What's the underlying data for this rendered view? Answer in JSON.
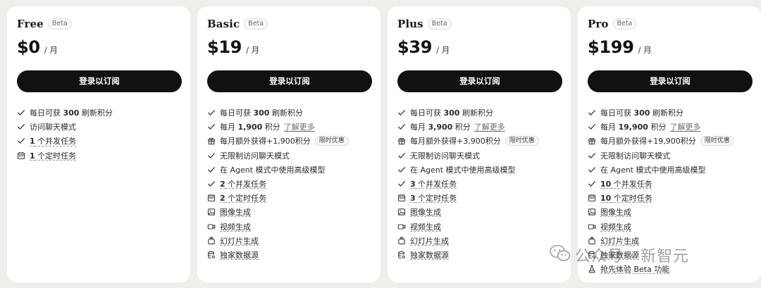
{
  "plans": [
    {
      "name": "Free",
      "badge": "Beta",
      "price": "$0",
      "period": "/ 月",
      "cta": "登录以订阅",
      "features": [
        {
          "icon": "check-icon",
          "pre": "每日可获 ",
          "bold": "300",
          "post": " 刷新积分"
        },
        {
          "icon": "check-icon",
          "pre": "访问聊天模式"
        },
        {
          "icon": "check-icon",
          "bold_ul": "1",
          "post_ul": " 个并发任务"
        },
        {
          "icon": "calendar-icon",
          "bold_ul": "1",
          "post_ul": " 个定时任务"
        }
      ]
    },
    {
      "name": "Basic",
      "badge": "Beta",
      "price": "$19",
      "period": "/ 月",
      "cta": "登录以订阅",
      "features": [
        {
          "icon": "check-icon",
          "pre": "每日可获 ",
          "bold": "300",
          "post": " 刷新积分"
        },
        {
          "icon": "check-icon",
          "pre": "每月 ",
          "bold": "1,900",
          "post": " 积分",
          "link": "了解更多"
        },
        {
          "icon": "gift-icon",
          "pre": "每月额外获得+1,900积分",
          "tag": "限时优惠"
        },
        {
          "icon": "check-icon",
          "pre": "无限制访问聊天模式"
        },
        {
          "icon": "check-icon",
          "pre": "在 Agent 模式中使用高级模型"
        },
        {
          "icon": "check-icon",
          "bold_ul": "2",
          "post_ul": " 个并发任务"
        },
        {
          "icon": "calendar-icon",
          "bold_ul": "2",
          "post_ul": " 个定时任务"
        },
        {
          "icon": "image-icon",
          "pre_ul": "图像生成"
        },
        {
          "icon": "video-icon",
          "pre_ul": "视频生成"
        },
        {
          "icon": "slides-icon",
          "pre_ul": "幻灯片生成"
        },
        {
          "icon": "database-icon",
          "pre_ul": "独家数据源"
        }
      ]
    },
    {
      "name": "Plus",
      "badge": "Beta",
      "price": "$39",
      "period": "/ 月",
      "cta": "登录以订阅",
      "features": [
        {
          "icon": "check-icon",
          "pre": "每日可获 ",
          "bold": "300",
          "post": " 刷新积分"
        },
        {
          "icon": "check-icon",
          "pre": "每月 ",
          "bold": "3,900",
          "post": " 积分",
          "link": "了解更多"
        },
        {
          "icon": "gift-icon",
          "pre": "每月额外获得+3,900积分",
          "tag": "限时优惠"
        },
        {
          "icon": "check-icon",
          "pre": "无限制访问聊天模式"
        },
        {
          "icon": "check-icon",
          "pre": "在 Agent 模式中使用高级模型"
        },
        {
          "icon": "check-icon",
          "bold_ul": "3",
          "post_ul": " 个并发任务"
        },
        {
          "icon": "calendar-icon",
          "bold_ul": "3",
          "post_ul": " 个定时任务"
        },
        {
          "icon": "image-icon",
          "pre_ul": "图像生成"
        },
        {
          "icon": "video-icon",
          "pre_ul": "视频生成"
        },
        {
          "icon": "slides-icon",
          "pre_ul": "幻灯片生成"
        },
        {
          "icon": "database-icon",
          "pre_ul": "独家数据源"
        }
      ]
    },
    {
      "name": "Pro",
      "badge": "Beta",
      "price": "$199",
      "period": "/ 月",
      "cta": "登录以订阅",
      "features": [
        {
          "icon": "check-icon",
          "pre": "每日可获 ",
          "bold": "300",
          "post": " 刷新积分"
        },
        {
          "icon": "check-icon",
          "pre": "每月 ",
          "bold": "19,900",
          "post": " 积分",
          "link": "了解更多"
        },
        {
          "icon": "gift-icon",
          "pre": "每月额外获得+19,900积分",
          "tag": "限时优惠"
        },
        {
          "icon": "check-icon",
          "pre": "无限制访问聊天模式"
        },
        {
          "icon": "check-icon",
          "pre": "在 Agent 模式中使用高级模型"
        },
        {
          "icon": "check-icon",
          "bold_ul": "10",
          "post_ul": " 个并发任务"
        },
        {
          "icon": "calendar-icon",
          "bold_ul": "10",
          "post_ul": " 个定时任务"
        },
        {
          "icon": "image-icon",
          "pre_ul": "图像生成"
        },
        {
          "icon": "video-icon",
          "pre_ul": "视频生成"
        },
        {
          "icon": "slides-icon",
          "pre_ul": "幻灯片生成"
        },
        {
          "icon": "database-icon",
          "pre_ul": "独家数据源"
        },
        {
          "icon": "flask-icon",
          "pre_ul": "抢先体验 Beta 功能"
        }
      ]
    }
  ],
  "watermark": {
    "text": "公众号 · 新智元",
    "icon": "wechat-icon"
  }
}
